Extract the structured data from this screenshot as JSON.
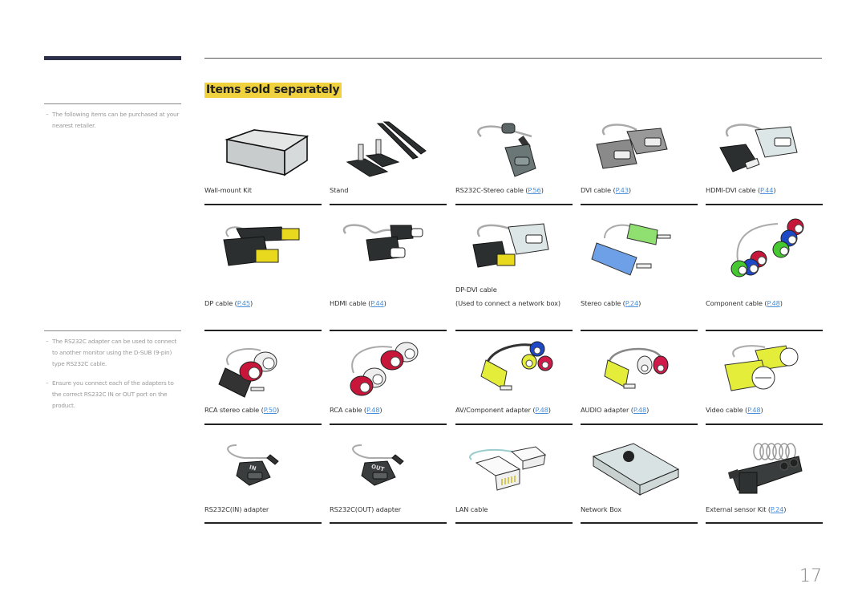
{
  "page": {
    "title": "Items sold separately",
    "page_number": "17",
    "colors": {
      "title_highlight": "#f0d23f",
      "link": "#4a90d9",
      "header_bar": "#2b2f4a"
    }
  },
  "sidebar": {
    "notes": [
      {
        "dash": "–",
        "text": "The following items can be purchased at your nearest retailer."
      },
      {
        "dash": "–",
        "text": "The RS232C adapter can be used to connect to another monitor using the D-SUB (9-pin) type RS232C cable."
      },
      {
        "dash": "–",
        "text": "Ensure you connect each of the adapters to the correct RS232C IN or OUT port on the product."
      }
    ]
  },
  "items": [
    {
      "name": "Wall-mount Kit",
      "ref": "",
      "icon": "wall-mount-kit"
    },
    {
      "name": "Stand",
      "ref": "",
      "icon": "stand"
    },
    {
      "name": "RS232C-Stereo cable (",
      "ref": "P.56",
      "suffix": ")",
      "icon": "rs232c-stereo-cable"
    },
    {
      "name": "DVI cable (",
      "ref": "P.43",
      "suffix": ")",
      "icon": "dvi-cable"
    },
    {
      "name": "HDMI-DVI cable (",
      "ref": "P.44",
      "suffix": ")",
      "icon": "hdmi-dvi-cable"
    },
    {
      "name": "DP cable (",
      "ref": "P.45",
      "suffix": ")",
      "icon": "dp-cable"
    },
    {
      "name": "HDMI cable (",
      "ref": "P.44",
      "suffix": ")",
      "icon": "hdmi-cable"
    },
    {
      "name": "DP-DVI cable",
      "note": "(Used to connect a network box)",
      "icon": "dp-dvi-cable"
    },
    {
      "name": "Stereo cable (",
      "ref": "P.24",
      "suffix": ")",
      "icon": "stereo-cable"
    },
    {
      "name": "Component cable (",
      "ref": "P.48",
      "suffix": ")",
      "icon": "component-cable"
    },
    {
      "name": "RCA stereo cable (",
      "ref": "P.50",
      "suffix": ")",
      "icon": "rca-stereo-cable"
    },
    {
      "name": "RCA cable (",
      "ref": "P.48",
      "suffix": ")",
      "icon": "rca-cable"
    },
    {
      "name": "AV/Component adapter (",
      "ref": "P.48",
      "suffix": ")",
      "icon": "av-component-adapter"
    },
    {
      "name": "AUDIO adapter (",
      "ref": "P.48",
      "suffix": ")",
      "icon": "audio-adapter"
    },
    {
      "name": "Video cable (",
      "ref": "P.48",
      "suffix": ")",
      "icon": "video-cable"
    },
    {
      "name": "RS232C(IN) adapter",
      "ref": "",
      "icon": "rs232c-in-adapter",
      "badge": "IN"
    },
    {
      "name": "RS232C(OUT) adapter",
      "ref": "",
      "icon": "rs232c-out-adapter",
      "badge": "OUT"
    },
    {
      "name": "LAN cable",
      "ref": "",
      "icon": "lan-cable"
    },
    {
      "name": "Network Box",
      "ref": "",
      "icon": "network-box"
    },
    {
      "name": "External sensor Kit (",
      "ref": "P.24",
      "suffix": ")",
      "icon": "external-sensor-kit"
    }
  ]
}
